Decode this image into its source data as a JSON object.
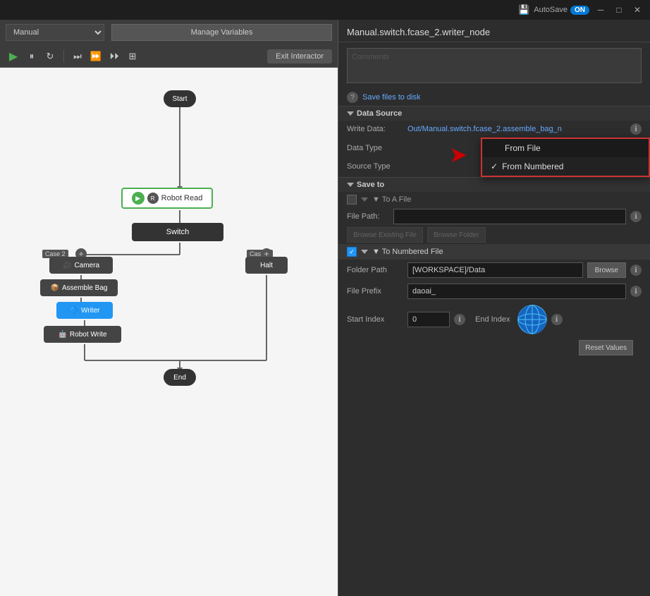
{
  "titlebar": {
    "minimize": "─",
    "maximize": "□",
    "close": "✕",
    "autosave_label": "AutoSave",
    "autosave_toggle": "ON",
    "save_icon": "💾"
  },
  "left_panel": {
    "mode": "Manual",
    "manage_vars": "Manage Variables",
    "exit_btn": "Exit Interactor"
  },
  "flow": {
    "start": "Start",
    "end": "End",
    "robot_read": "Robot Read",
    "switch": "Switch",
    "camera": "Camera",
    "assemble_bag": "Assemble Bag",
    "writer": "Writer",
    "robot_write": "Robot Write",
    "halt": "Halt",
    "case2": "Case 2",
    "case3": "Case 3"
  },
  "right_panel": {
    "title": "Manual.switch.fcase_2.writer_node",
    "comments_placeholder": "Comments",
    "save_files_link": "Save files to disk",
    "data_source_header": "Data Source",
    "write_data_label": "Write Data:",
    "write_data_value": "Out/Manual.switch.fcase_2.assemble_bag_n",
    "data_type_label": "Data Type",
    "source_type_label": "Source Type",
    "dropdown": {
      "from_file": "From File",
      "from_numbered": "From Numbered",
      "selected": "from_numbered"
    },
    "save_to_header": "Save to",
    "to_a_file_label": "▼ To A File",
    "file_path_label": "File Path:",
    "browse_existing": "Browse Existing File",
    "browse_folder": "Browse Folder",
    "to_numbered_label": "▼ To Numbered File",
    "folder_path_label": "Folder Path",
    "folder_path_value": "[WORKSPACE]/Data",
    "browse_btn": "Browse",
    "file_prefix_label": "File Prefix",
    "file_prefix_value": "daoai_",
    "start_index_label": "Start Index",
    "start_index_value": "0",
    "end_index_label": "End Index",
    "reset_btn": "Reset Values"
  }
}
